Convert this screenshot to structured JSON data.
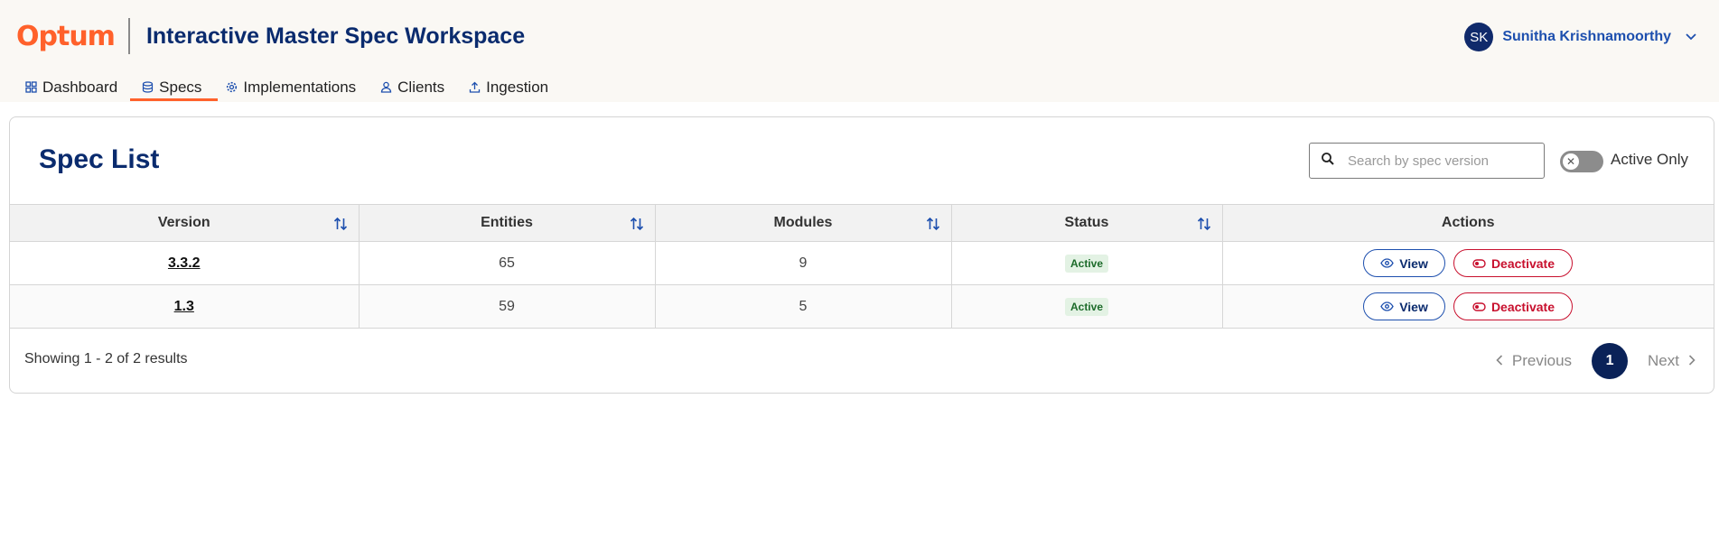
{
  "brand": {
    "logo": "Optum",
    "app_title": "Interactive Master Spec Workspace",
    "accent": "#ff612b",
    "primary": "#0a2b6e"
  },
  "user": {
    "initials": "SK",
    "name": "Sunitha Krishnamoorthy"
  },
  "nav": [
    {
      "label": "Dashboard",
      "icon": "grid-icon"
    },
    {
      "label": "Specs",
      "icon": "database-icon",
      "active": true
    },
    {
      "label": "Implementations",
      "icon": "gear-icon"
    },
    {
      "label": "Clients",
      "icon": "user-icon"
    },
    {
      "label": "Ingestion",
      "icon": "upload-icon"
    }
  ],
  "spec_list": {
    "title": "Spec List",
    "search_placeholder": "Search by spec version",
    "toggle_label": "Active Only",
    "columns": [
      "Version",
      "Entities",
      "Modules",
      "Status",
      "Actions"
    ],
    "rows": [
      {
        "version": "3.3.2",
        "entities": "65",
        "modules": "9",
        "status": "Active"
      },
      {
        "version": "1.3",
        "entities": "59",
        "modules": "5",
        "status": "Active"
      }
    ],
    "view_label": "View",
    "deactivate_label": "Deactivate",
    "showing": "Showing 1 - 2 of 2 results",
    "previous": "Previous",
    "page": "1",
    "next": "Next"
  }
}
